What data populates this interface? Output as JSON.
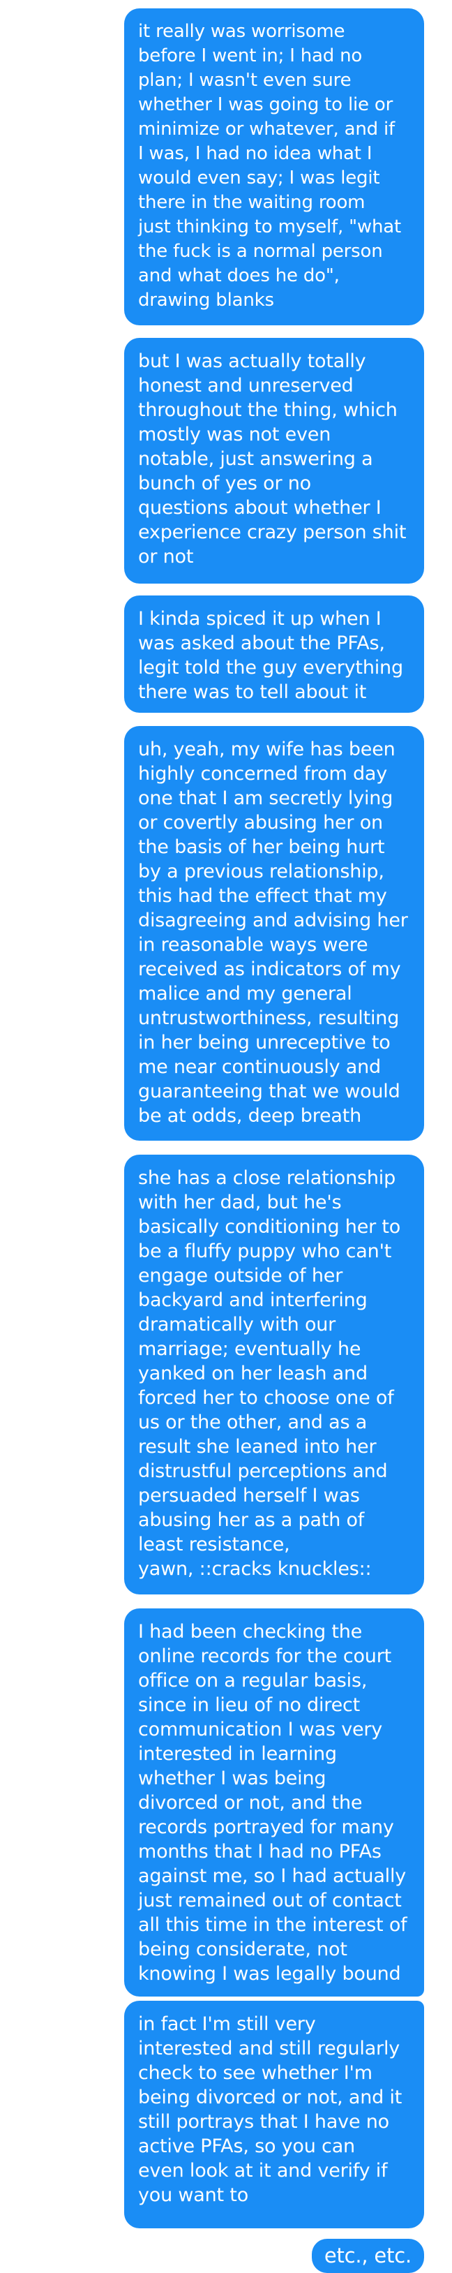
{
  "messages": [
    {
      "lines": [
        "it really was worrisome",
        "before I went in; I had no",
        "plan; I wasn't even sure",
        "whether I was going to lie or",
        "minimize or whatever, and if",
        "I was, I had no idea what I",
        "would even say; I was legit",
        "there in the waiting room",
        "just thinking to myself, \"what",
        "the fuck is a normal person",
        "and what does he do\",",
        "drawing blanks"
      ]
    },
    {
      "lines": [
        "but I was actually totally",
        "honest and unreserved",
        "throughout the thing, which",
        "mostly was not even",
        "notable, just answering a",
        "bunch of yes or no",
        "questions about whether I",
        "experience crazy person shit",
        "or not"
      ]
    },
    {
      "lines": [
        "I kinda spiced it up when I",
        "was asked about the PFAs,",
        "legit told the guy everything",
        "there was to tell about it"
      ]
    },
    {
      "lines": [
        "uh, yeah, my wife has been",
        "highly concerned from day",
        "one that I am secretly lying",
        "or covertly abusing her on",
        "the basis of her being hurt",
        "by a previous relationship,",
        "this had the effect that my",
        "disagreeing and advising her",
        "in reasonable ways were",
        "received as indicators of my",
        "malice and my general",
        "untrustworthiness, resulting",
        "in her being unreceptive to",
        "me near continuously and",
        "guaranteeing that we would",
        "be at odds, deep breath"
      ]
    },
    {
      "lines": [
        "she has a close relationship",
        "with her dad, but he's",
        "basically conditioning her to",
        "be a fluffy puppy who can't",
        "engage outside of her",
        "backyard and interfering",
        "dramatically with our",
        "marriage; eventually he",
        "yanked on her leash and",
        "forced her to choose one of",
        "us or the other, and as a",
        "result she leaned into her",
        "distrustful perceptions and",
        "persuaded herself I was",
        "abusing her as a path of",
        "least resistance,",
        "yawn, ::cracks knuckles::"
      ]
    },
    {
      "lines": [
        "I had been checking the",
        "online records for the court",
        "office on a regular basis,",
        "since in lieu of no direct",
        "communication I was very",
        "interested in learning",
        "whether I was being",
        "divorced or not, and the",
        "records portrayed for many",
        "months that I had no PFAs",
        "against me, so I had actually",
        "just remained out of contact",
        "all this time in the interest of",
        "being considerate, not",
        "knowing I was legally bound"
      ]
    },
    {
      "lines": [
        "in fact I'm still very",
        "interested and still regularly",
        "check to see whether I'm",
        "being divorced or not, and it",
        "still portrays that I have no",
        "active PFAs, so you can",
        "even look at it and verify if",
        "you want to"
      ]
    },
    {
      "lines": [
        "etc., etc."
      ]
    }
  ],
  "colors": {
    "bubble_background": "#1a8df5",
    "bubble_text": "#ffffff",
    "page_background": "#ffffff"
  }
}
